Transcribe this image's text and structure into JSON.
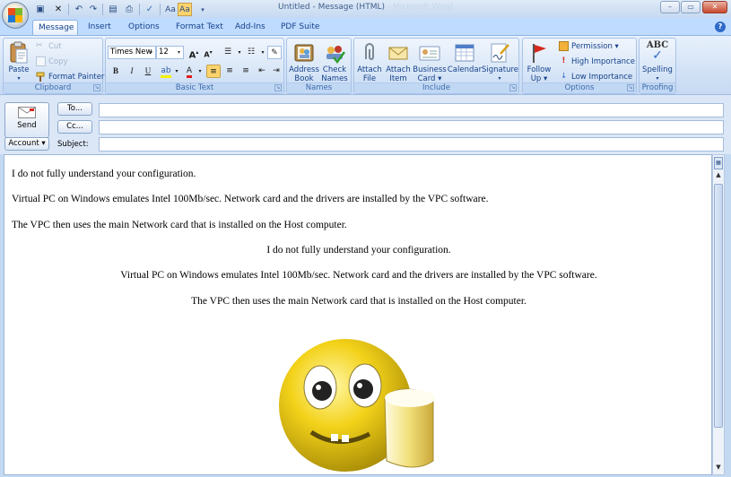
{
  "window": {
    "title": "Untitled - Message (HTML)",
    "title_suffix": "Microsoft Word",
    "controls": {
      "minimize": "–",
      "restore": "▭",
      "close": "✕"
    }
  },
  "quick_access": [
    {
      "name": "save-icon",
      "glyph": "▣"
    },
    {
      "name": "delete-icon",
      "glyph": "✕"
    },
    {
      "name": "undo-icon",
      "glyph": "↶"
    },
    {
      "name": "redo-icon",
      "glyph": "↷"
    },
    {
      "name": "print-preview-icon",
      "glyph": "▤"
    },
    {
      "name": "print-icon",
      "glyph": "⎙"
    },
    {
      "name": "spelling-check-icon",
      "glyph": "✓"
    },
    {
      "name": "font-aa-icon",
      "glyph": "Aa"
    },
    {
      "name": "font-aa-highlight-icon",
      "glyph": "Aa"
    }
  ],
  "tabs": [
    "Message",
    "Insert",
    "Options",
    "Format Text",
    "Add-Ins",
    "PDF Suite"
  ],
  "active_tab": "Message",
  "ribbon": {
    "clipboard": {
      "label": "Clipboard",
      "paste": "Paste",
      "cut": "Cut",
      "copy": "Copy",
      "format_painter": "Format Painter"
    },
    "basic_text": {
      "label": "Basic Text",
      "font": "Times New",
      "size": "12",
      "bold": "B",
      "italic": "I",
      "underline": "U"
    },
    "names": {
      "label": "Names",
      "address_book": [
        "Address",
        "Book"
      ],
      "check_names": [
        "Check",
        "Names"
      ]
    },
    "include": {
      "label": "Include",
      "attach_file": [
        "Attach",
        "File"
      ],
      "attach_item": [
        "Attach",
        "Item"
      ],
      "business_card": [
        "Business",
        "Card ▾"
      ],
      "calendar": "Calendar",
      "signature": "Signature"
    },
    "options": {
      "label": "Options",
      "follow_up": [
        "Follow",
        "Up ▾"
      ],
      "permission": "Permission ▾",
      "high_importance": "High Importance",
      "low_importance": "Low Importance"
    },
    "proofing": {
      "label": "Proofing",
      "spelling": "Spelling",
      "abc": "ABC"
    }
  },
  "header": {
    "send": "Send",
    "to": "To...",
    "cc": "Cc...",
    "account": "Account ▾",
    "subject_label": "Subject:",
    "to_value": "",
    "cc_value": "",
    "subject_value": ""
  },
  "body": {
    "paragraphs_left": [
      "I do not fully understand your configuration.",
      "Virtual PC on Windows emulates Intel 100Mb/sec. Network card and the drivers are installed by the VPC software.",
      "The VPC then uses the main Network card that is installed on the Host computer."
    ],
    "paragraphs_center": [
      "I do not fully understand your configuration.",
      "Virtual PC on Windows emulates Intel 100Mb/sec. Network card and the drivers are installed by the VPC software.",
      "The VPC then uses the main Network card that is installed on the Host computer."
    ]
  },
  "colors": {
    "ribbon_text": "#15428b",
    "accent_orange": "#f0a028",
    "highlight_active": "#fbd36d",
    "smiley_yellow": "#f3d21a",
    "beer": "#f2e07a"
  }
}
